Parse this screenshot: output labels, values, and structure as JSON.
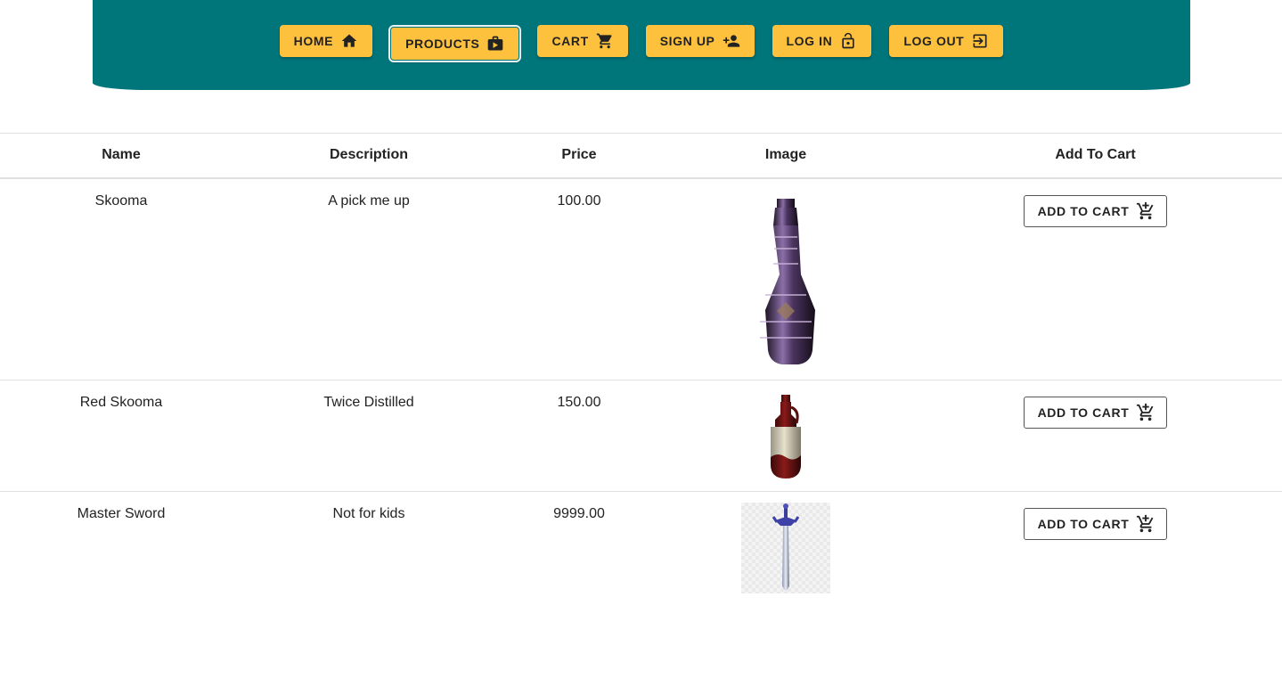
{
  "nav": {
    "items": [
      {
        "label": "HOME",
        "icon": "home-icon"
      },
      {
        "label": "PRODUCTS",
        "icon": "store-icon",
        "active": true
      },
      {
        "label": "CART",
        "icon": "cart-icon"
      },
      {
        "label": "SIGN UP",
        "icon": "person-add-icon"
      },
      {
        "label": "LOG IN",
        "icon": "lock-open-icon"
      },
      {
        "label": "LOG OUT",
        "icon": "logout-icon"
      }
    ]
  },
  "table": {
    "headers": [
      "Name",
      "Description",
      "Price",
      "Image",
      "Add To Cart"
    ],
    "rows": [
      {
        "name": "Skooma",
        "description": "A pick me up",
        "price": "100.00",
        "image": "purple-bottle-image",
        "button": "ADD TO CART"
      },
      {
        "name": "Red Skooma",
        "description": "Twice Distilled",
        "price": "150.00",
        "image": "red-bottle-image",
        "button": "ADD TO CART"
      },
      {
        "name": "Master Sword",
        "description": "Not for kids",
        "price": "9999.00",
        "image": "sword-image",
        "button": "ADD TO CART"
      }
    ]
  },
  "colors": {
    "header_bg": "#00767b",
    "nav_button_bg": "#fec13e"
  }
}
